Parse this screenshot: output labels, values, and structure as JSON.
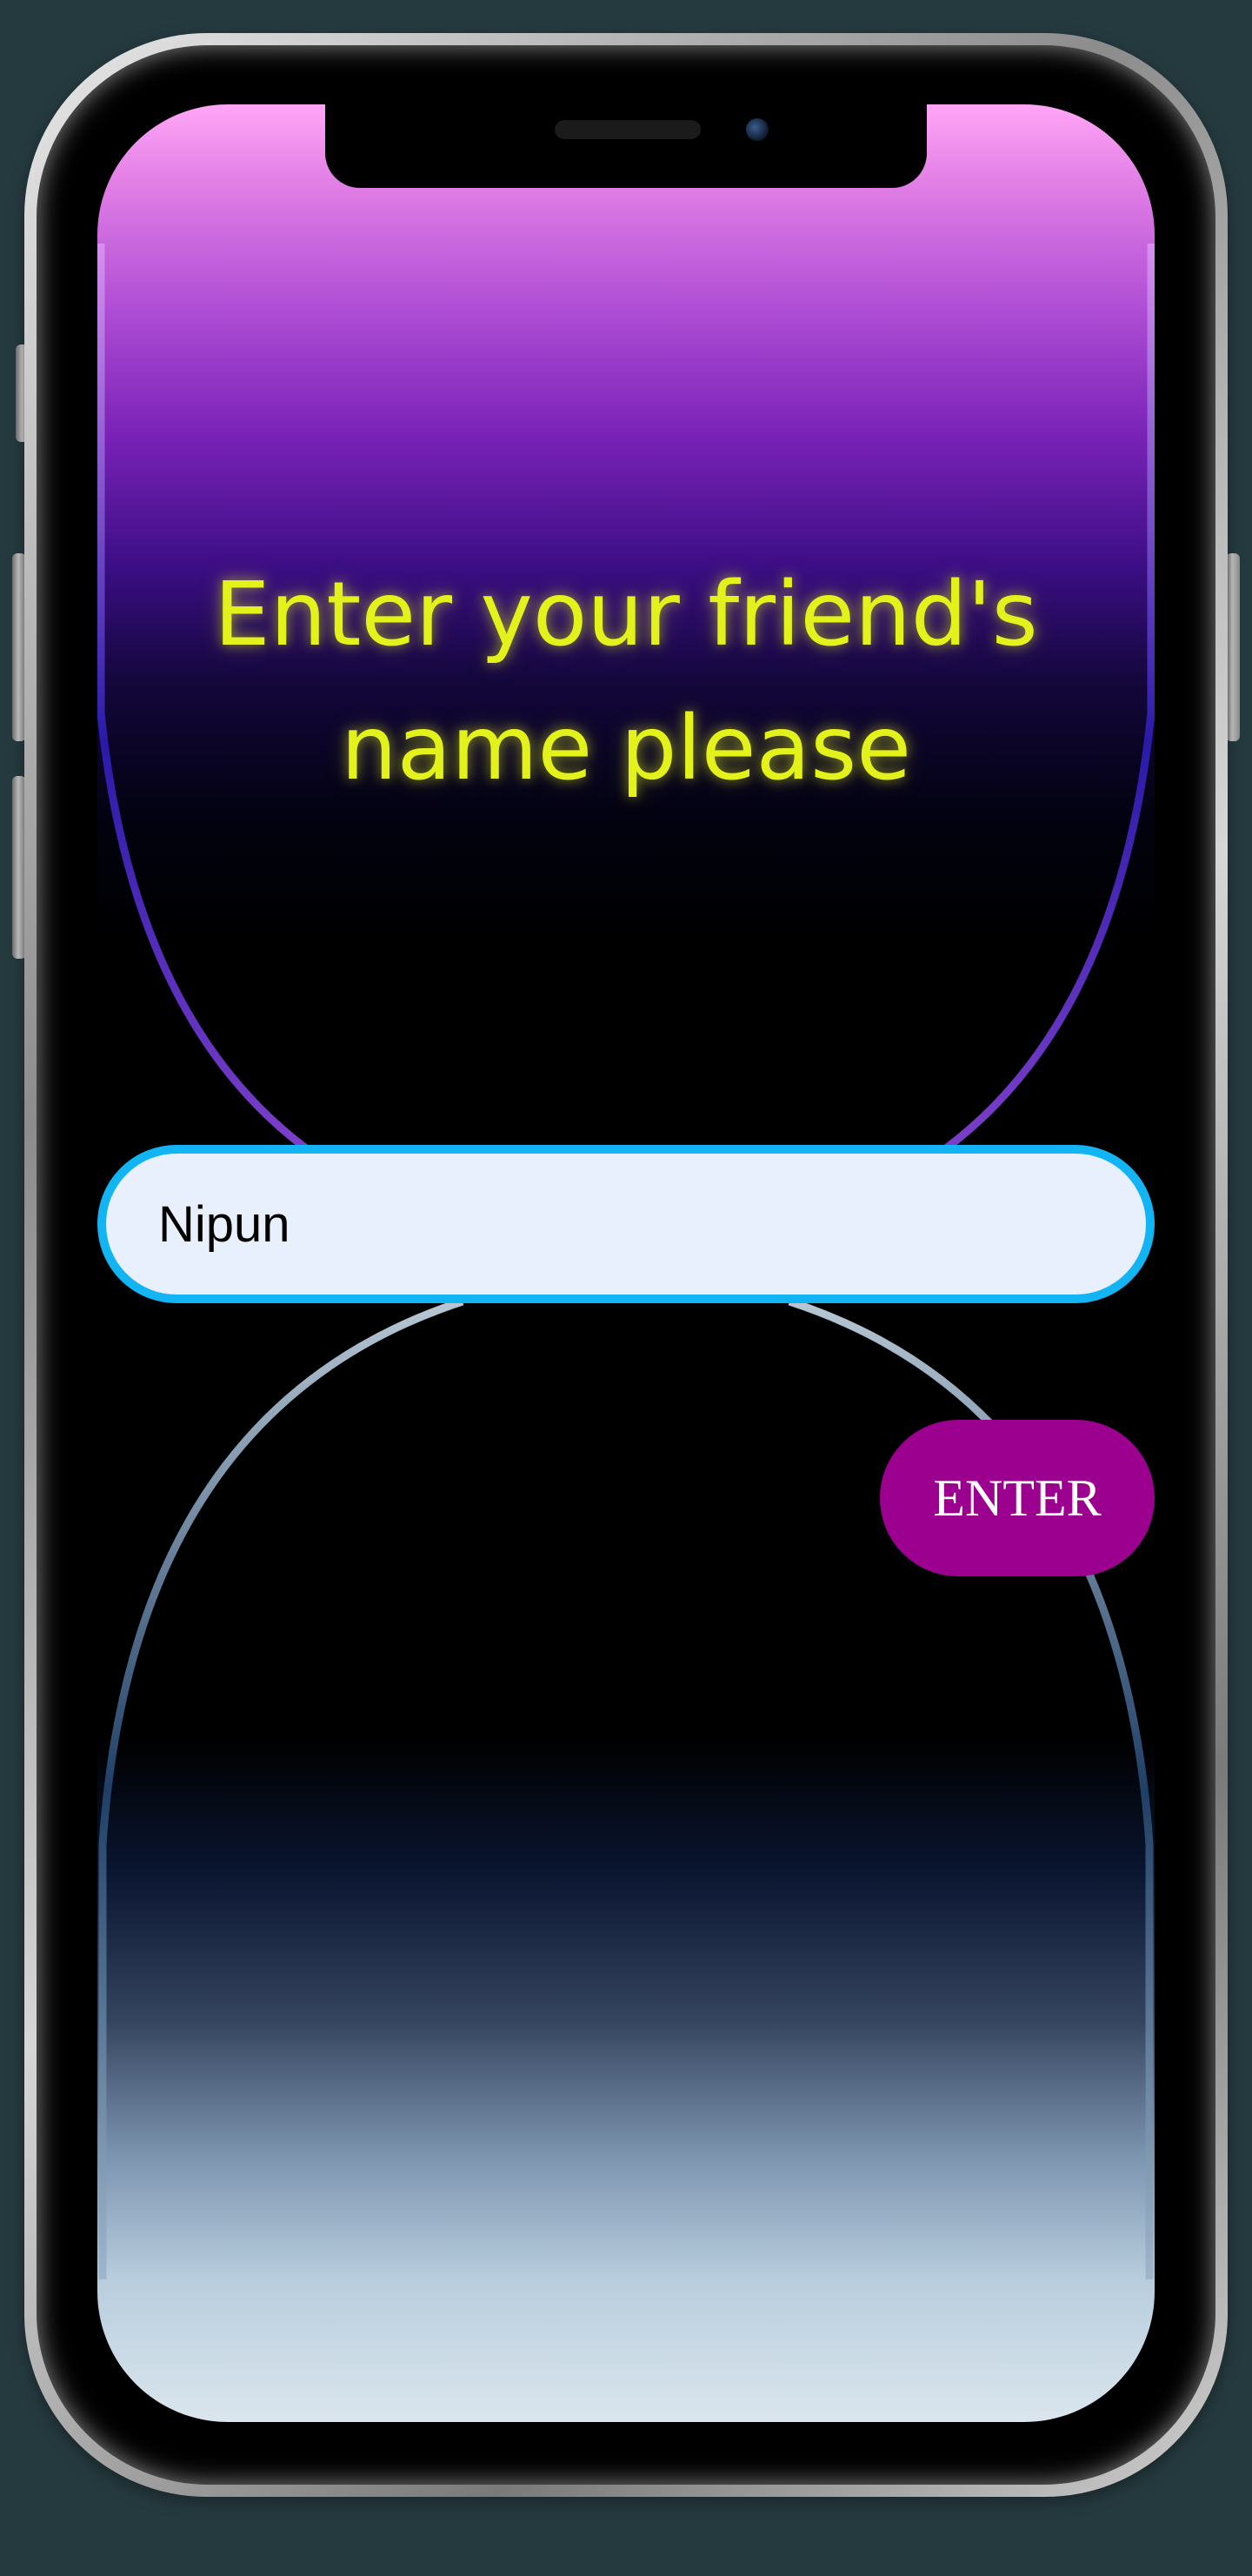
{
  "heading": {
    "line1": "Enter your friend's",
    "line2": "name please"
  },
  "name_input": {
    "value": "Nipun",
    "placeholder": ""
  },
  "enter_button": {
    "label": "ENTER"
  },
  "colors": {
    "page_background": "#253a3f",
    "heading_text": "#e4f21c",
    "input_border": "#13b4f4",
    "input_background": "#e8f0fe",
    "button_background": "#9b008f",
    "button_text": "#ffffff"
  },
  "icons": {
    "speaker": "earpiece-speaker-icon",
    "camera": "front-camera-icon"
  }
}
